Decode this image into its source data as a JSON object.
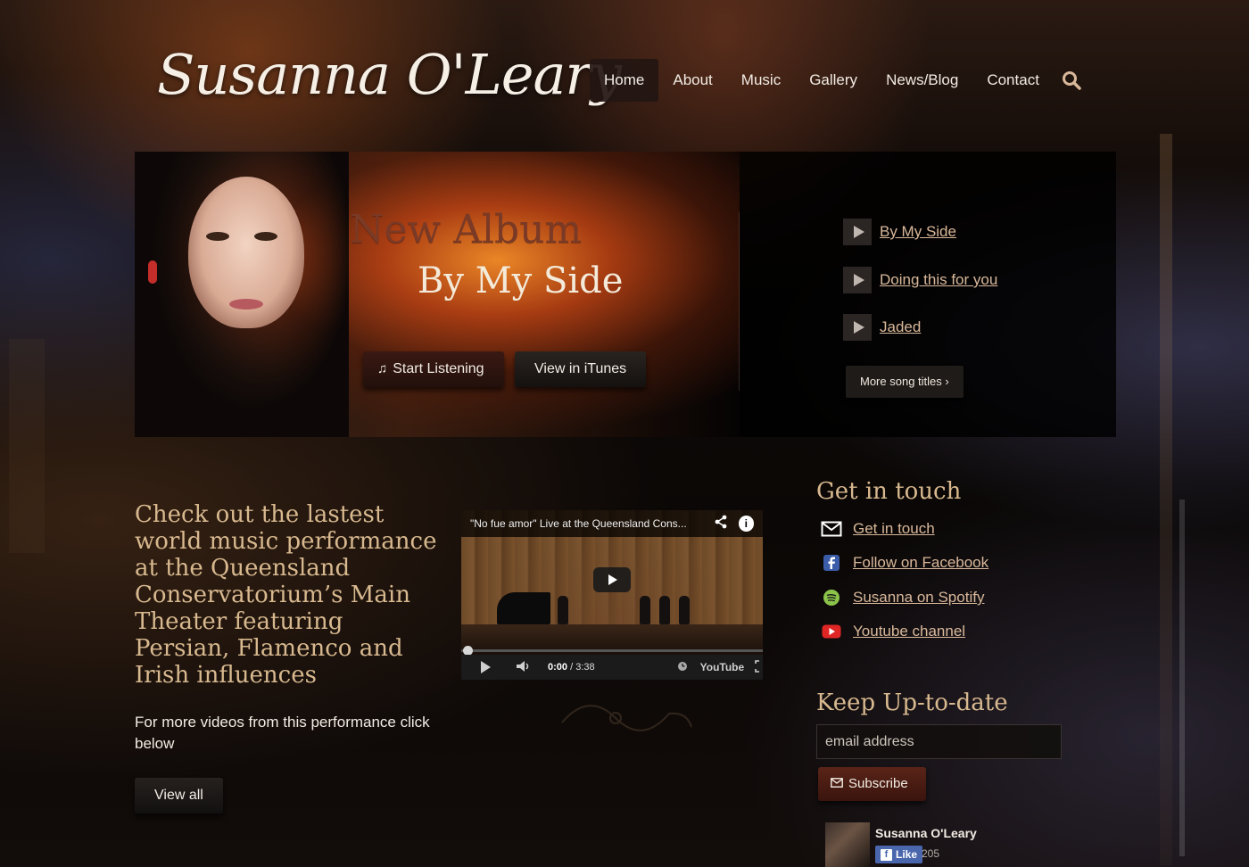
{
  "header": {
    "logo_text": "Susanna O'Leary",
    "nav": [
      {
        "label": "Home",
        "active": true
      },
      {
        "label": "About"
      },
      {
        "label": "Music"
      },
      {
        "label": "Gallery"
      },
      {
        "label": "News/Blog"
      },
      {
        "label": "Contact"
      }
    ],
    "search_icon": "search-icon"
  },
  "hero": {
    "title_line1": "New Album",
    "title_line2": "By My Side",
    "listen_button": "Start Listening",
    "itunes_button": "View in iTunes",
    "songs": [
      {
        "title": "By My Side"
      },
      {
        "title": "Doing this for you"
      },
      {
        "title": "Jaded"
      }
    ],
    "more_button": "More song titles ›"
  },
  "promo": {
    "text": "Check out the lastest world music performance at the Queensland Conservatorium’s Main Theater featuring Persian, Flamenco and Irish influences",
    "subtext": "For more videos from this performance click below",
    "view_all_button": "View all"
  },
  "video": {
    "title": "\"No fue amor\" Live at the Queensland Cons...",
    "time_current": "0:00",
    "time_total": "/ 3:38",
    "youtube_label": "YouTube"
  },
  "sidebar": {
    "contact_heading": "Get in touch",
    "contact_links": [
      {
        "label": "Get in touch",
        "icon": "mail-icon"
      },
      {
        "label": "Follow on Facebook",
        "icon": "facebook-icon"
      },
      {
        "label": "Susanna on Spotify",
        "icon": "spotify-icon"
      },
      {
        "label": "Youtube channel",
        "icon": "youtube-icon"
      }
    ],
    "newsletter_heading": "Keep Up-to-date",
    "email_placeholder": "email address",
    "subscribe_button": "Subscribe",
    "facebook_widget": {
      "page_name": "Susanna O'Leary",
      "like_label": "Like",
      "like_count": "205"
    }
  },
  "colors": {
    "accent_gold": "#d8b98f",
    "link": "#d9b89a",
    "album_title_red": "#7a3a26"
  }
}
